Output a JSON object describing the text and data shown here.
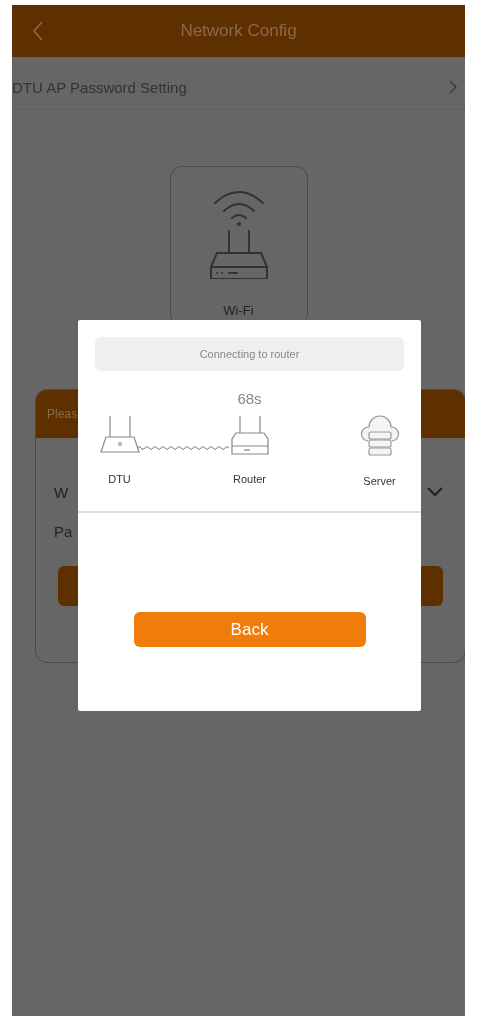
{
  "nav_bar": {
    "title": "Network Config"
  },
  "settings_row": {
    "label": "DTU AP Password Setting"
  },
  "mode_card": {
    "label": "Wi-Fi"
  },
  "config_card": {
    "header": "Pleas",
    "wifi_label": "W",
    "password_label": "Pa"
  },
  "dialog": {
    "status": "Connecting to router",
    "countdown": "68s",
    "nodes": [
      {
        "kind": "dtu",
        "label": "DTU"
      },
      {
        "kind": "router",
        "label": "Router"
      },
      {
        "kind": "server",
        "label": "Server"
      }
    ],
    "button": "Back"
  }
}
